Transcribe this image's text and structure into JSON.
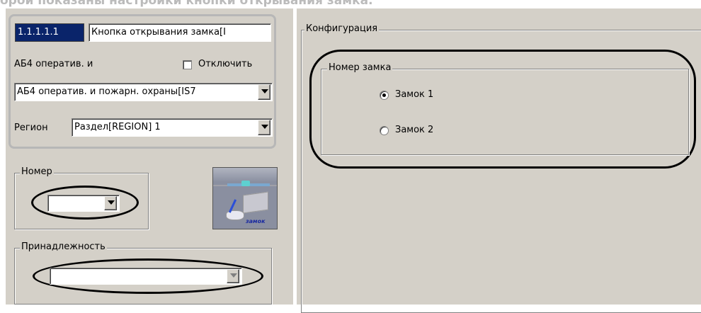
{
  "header_text": "орой показаны настройки кнопки открывания замка.",
  "device": {
    "id": "1.1.1.1.1",
    "name": "Кнопка открывания замка[I",
    "parent_label": "АБ4 оператив. и",
    "disable_label": "Отключить",
    "disable_checked": false,
    "parent_select": "АБ4 оператив. и пожарн. охраны[IS7",
    "region_label": "Регион",
    "region_select": "Раздел[REGION] 1"
  },
  "number_group": {
    "title": "Номер",
    "value": ""
  },
  "belonging_group": {
    "title": "Принадлежность",
    "value": ""
  },
  "icon": {
    "name": "lock-device-icon",
    "caption": "замок"
  },
  "config": {
    "title": "Конфигурация",
    "lock_group_title": "Номер замка",
    "options": [
      {
        "label": "Замок 1",
        "selected": true
      },
      {
        "label": "Замок 2",
        "selected": false
      }
    ]
  }
}
